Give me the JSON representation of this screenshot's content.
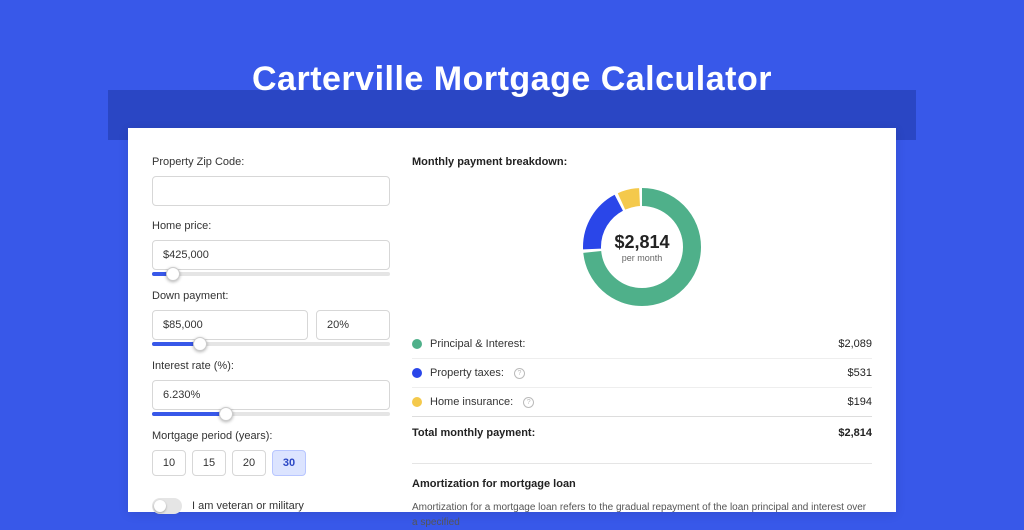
{
  "title": "Carterville Mortgage Calculator",
  "form": {
    "zip_label": "Property Zip Code:",
    "zip_value": "",
    "price_label": "Home price:",
    "price_value": "$425,000",
    "price_slider_pct": 9,
    "down_label": "Down payment:",
    "down_value": "$85,000",
    "down_pct_value": "20%",
    "down_slider_pct": 20,
    "rate_label": "Interest rate (%):",
    "rate_value": "6.230%",
    "rate_slider_pct": 31,
    "period_label": "Mortgage period (years):",
    "periods": [
      "10",
      "15",
      "20",
      "30"
    ],
    "period_active": 3,
    "veteran_label": "I am veteran or military"
  },
  "breakdown": {
    "title": "Monthly payment breakdown:",
    "center_amount": "$2,814",
    "center_sub": "per month",
    "items": [
      {
        "label": "Principal & Interest:",
        "value": "$2,089",
        "color": "#4fb08a",
        "info": false
      },
      {
        "label": "Property taxes:",
        "value": "$531",
        "color": "#2a46e9",
        "info": true
      },
      {
        "label": "Home insurance:",
        "value": "$194",
        "color": "#f4c94c",
        "info": true
      }
    ],
    "total_label": "Total monthly payment:",
    "total_value": "$2,814"
  },
  "chart_data": {
    "type": "pie",
    "title": "Monthly payment breakdown",
    "series": [
      {
        "name": "Principal & Interest",
        "value": 2089,
        "color": "#4fb08a"
      },
      {
        "name": "Property taxes",
        "value": 531,
        "color": "#2a46e9"
      },
      {
        "name": "Home insurance",
        "value": 194,
        "color": "#f4c94c"
      }
    ],
    "total": 2814
  },
  "amort": {
    "title": "Amortization for mortgage loan",
    "text": "Amortization for a mortgage loan refers to the gradual repayment of the loan principal and interest over a specified"
  }
}
